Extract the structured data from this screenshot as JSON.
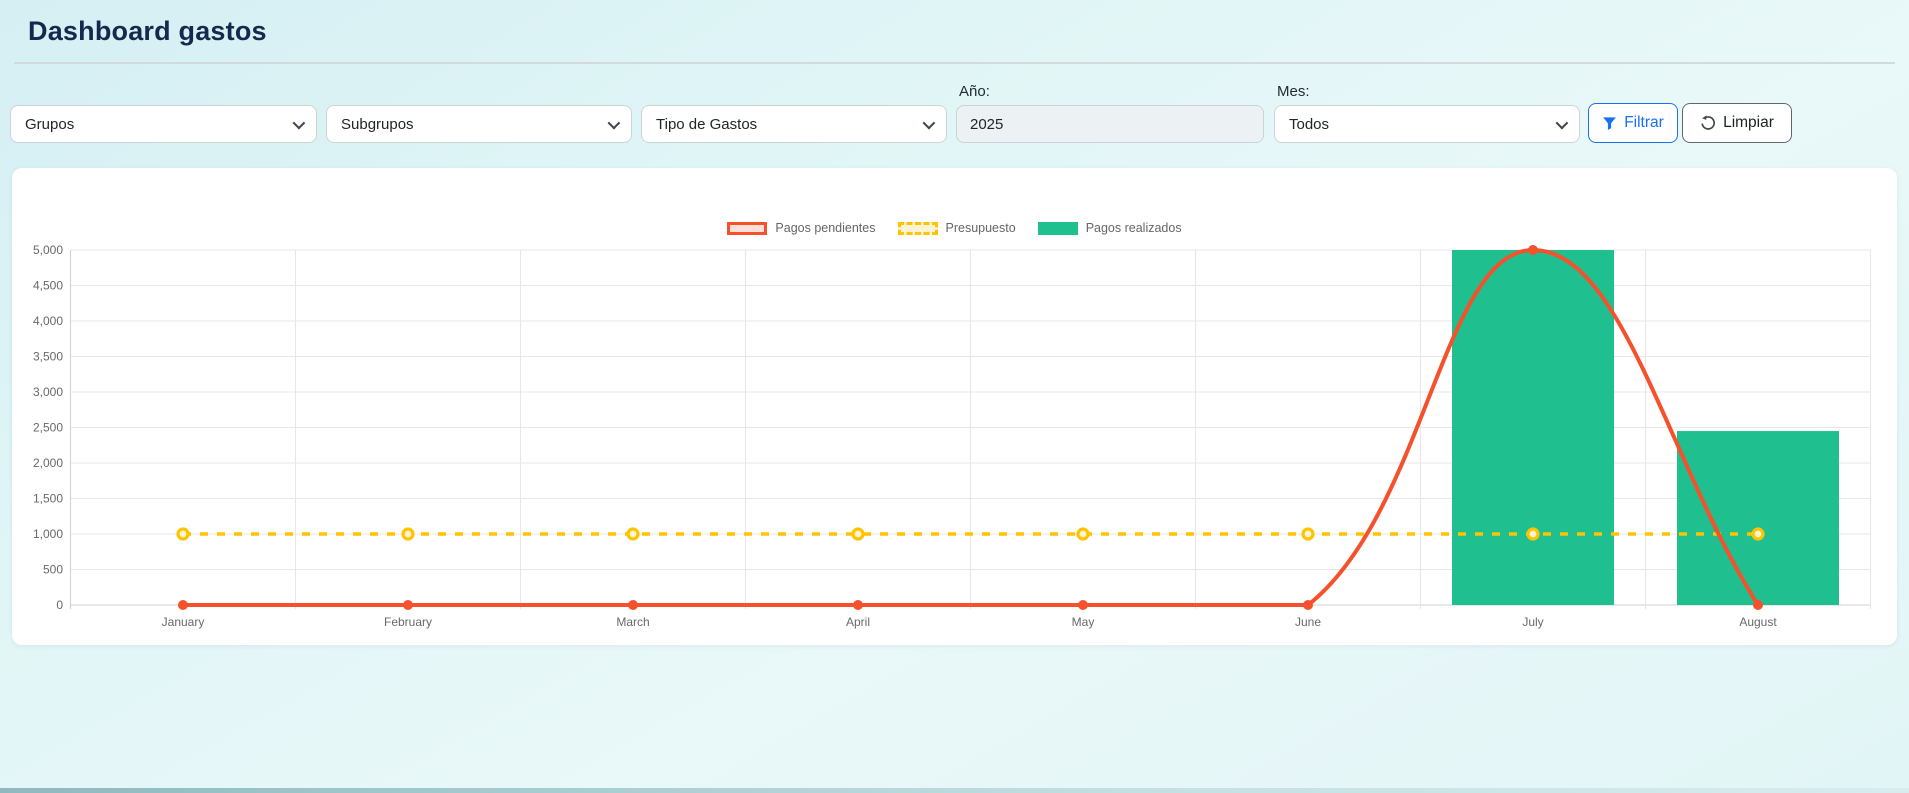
{
  "page": {
    "title": "Dashboard gastos"
  },
  "filters": {
    "groups_value": "Grupos",
    "subgroups_value": "Subgrupos",
    "expense_type_value": "Tipo de Gastos",
    "year_label": "Año:",
    "year_value": "2025",
    "month_label": "Mes:",
    "month_value": "Todos",
    "filter_button_label": "Filtrar",
    "clear_button_label": "Limpiar"
  },
  "icons": {
    "chevron": "chevron-down-icon",
    "filter": "filter-funnel-icon",
    "clear": "reload-icon"
  },
  "colors": {
    "accent_blue": "#1a6ff2",
    "title_navy": "#14294d",
    "grid": "#e7e7e7",
    "axis_border": "#d2d2d2",
    "tick_text": "#686868"
  },
  "chart_data": {
    "type": "mixed",
    "categories": [
      "January",
      "February",
      "March",
      "April",
      "May",
      "June",
      "July",
      "August"
    ],
    "series": [
      {
        "name": "Pagos pendientes",
        "type": "line",
        "line_style": "solid",
        "color": "#f4512c",
        "swatch_fill": "#fce0d8",
        "values": [
          0,
          0,
          0,
          0,
          0,
          0,
          5000,
          0
        ]
      },
      {
        "name": "Presupuesto",
        "type": "line",
        "line_style": "dashed",
        "color": "#ffc400",
        "swatch_fill": "#fdf3d2",
        "values": [
          1000,
          1000,
          1000,
          1000,
          1000,
          1000,
          1000,
          1000
        ]
      },
      {
        "name": "Pagos realizados",
        "type": "bar",
        "color": "#1fbf8f",
        "swatch_fill": "#1fbf8f",
        "values": [
          null,
          null,
          null,
          null,
          null,
          null,
          5000,
          2450
        ]
      }
    ],
    "ylim": [
      0,
      5000
    ],
    "ytick_step": 500,
    "grid": true,
    "legend_position": "top"
  }
}
